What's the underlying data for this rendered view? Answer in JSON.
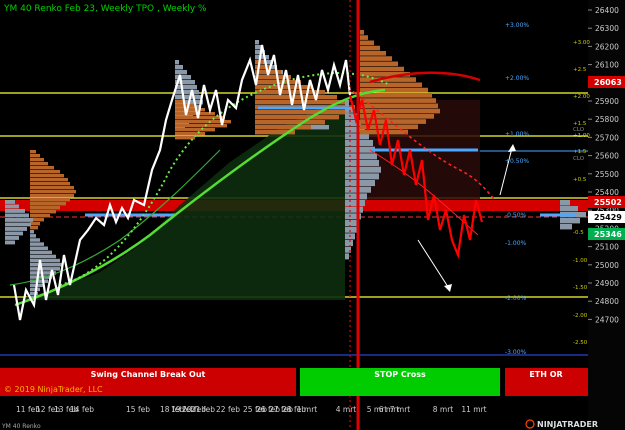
{
  "header": {
    "title": "YM 40 Renko Feb 23, Weekly TPO , Weekly %"
  },
  "copyright": "© 2019 NinjaTrader, LLC",
  "bottom_left_label": "YM 40 Renko",
  "brand": "NINJATRADER",
  "panels": [
    {
      "label": "Swing Channel Break Out",
      "color": "#cc0000"
    },
    {
      "label": "STOP Cross",
      "color": "#00cc00"
    },
    {
      "label": "ETH OR",
      "color": "#cc0000"
    }
  ],
  "price_axis": {
    "ticks": [
      "26400",
      "26300",
      "26200",
      "26100",
      "26000",
      "25900",
      "25800",
      "25700",
      "25600",
      "25500",
      "25400",
      "25300",
      "25200",
      "25100",
      "25000",
      "24900",
      "24800",
      "24700"
    ],
    "markers": [
      {
        "value": "26063",
        "color": "#d40000"
      },
      {
        "value": "25502",
        "color": "#d40000"
      },
      {
        "value": "25429",
        "color": "#ffffff"
      },
      {
        "value": "25346",
        "color": "#00b050"
      }
    ]
  },
  "time_axis": {
    "labels": [
      "11 feb",
      "12 feb",
      "13 feb",
      "14 feb",
      "15 feb",
      "18 feb",
      "19 feb",
      "20 feb",
      "21 feb",
      "22 feb",
      "25 feb",
      "26 feb",
      "27 feb",
      "28 feb",
      "1 mrt",
      "4 mrt",
      "5 mrt",
      "6 mrt",
      "7 mrt",
      "8 mrt",
      "11 mrt"
    ]
  },
  "percent_levels": [
    "+3.00%",
    "+2.00%",
    "+1.00%",
    "+0.50%",
    "-0.50%",
    "-1.00%",
    "-2.00%",
    "-3.00%"
  ],
  "right_levels": [
    "+3.00",
    "+2.5",
    "+2.00",
    "+1.5",
    "+1.00",
    "+1.5",
    "+0.5",
    "-0.5",
    "-1.00",
    "-1.50",
    "-2.00",
    "-2.50",
    "-3.00"
  ],
  "level_tags": [
    "CLO",
    "CLO"
  ],
  "colors": {
    "background": "#000000",
    "price_line": "#ffffff",
    "down_line": "#ff0000",
    "ma_light": "#66ee44",
    "ma_dark": "#228822",
    "yellow_level": "#ffff33",
    "blue_level": "#4aa8ff",
    "tpo_gray": "#8a98a8",
    "tpo_brown": "#b8652a"
  }
}
